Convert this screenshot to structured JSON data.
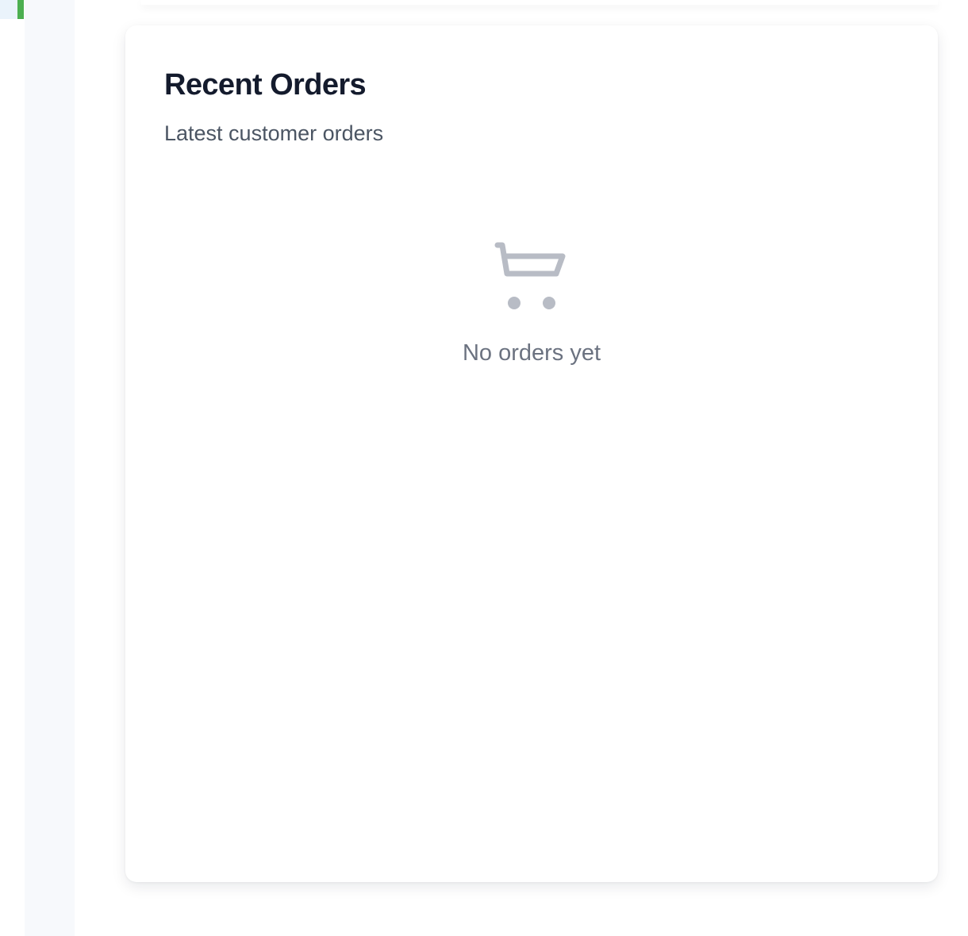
{
  "orders_card": {
    "title": "Recent Orders",
    "subtitle": "Latest customer orders",
    "empty_state": {
      "icon": "shopping-cart-icon",
      "message": "No orders yet"
    }
  },
  "colors": {
    "sidebar_active_accent": "#4caf50",
    "title": "#141b2d",
    "subtitle": "#4b5563",
    "empty_text": "#6b7280",
    "empty_icon": "#b8bcc5"
  }
}
